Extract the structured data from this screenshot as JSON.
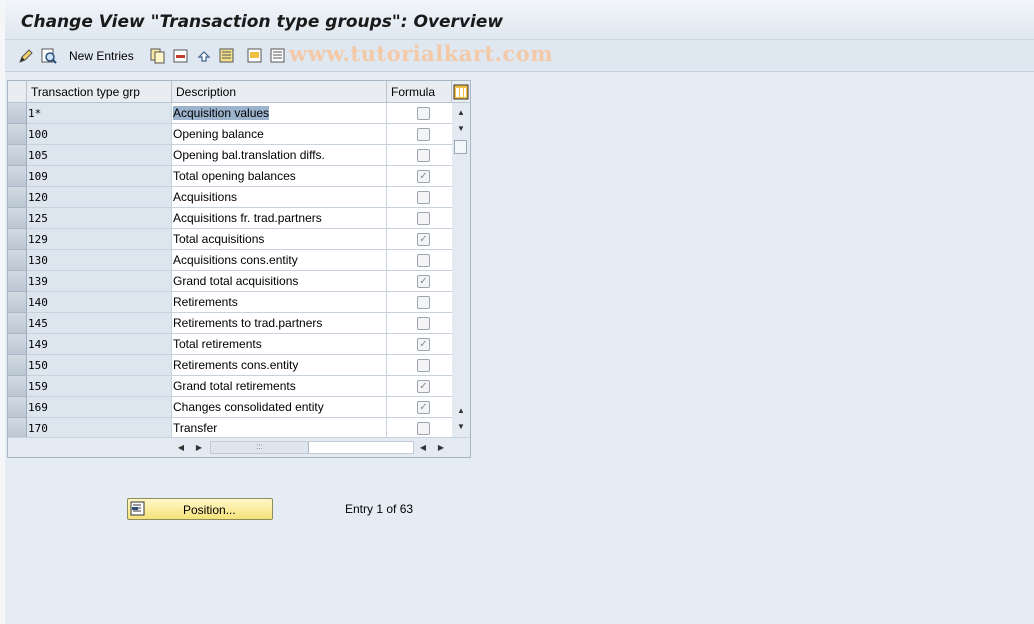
{
  "window": {
    "title": "Change View \"Transaction type groups\": Overview"
  },
  "toolbar": {
    "new_entries_label": "New Entries",
    "watermark": "www.tutorialkart.com",
    "icons": [
      "display-change-icon",
      "details-icon",
      "copy-as-icon",
      "delete-icon",
      "undo-icon",
      "select-all-icon",
      "select-block-icon",
      "deselect-all-icon"
    ]
  },
  "table": {
    "columns": {
      "group": "Transaction type grp",
      "description": "Description",
      "formula": "Formula"
    },
    "rows": [
      {
        "group": "1*",
        "description": "Acquisition values",
        "formula": false,
        "selected": true
      },
      {
        "group": "100",
        "description": "Opening balance",
        "formula": false
      },
      {
        "group": "105",
        "description": "Opening bal.translation diffs.",
        "formula": false
      },
      {
        "group": "109",
        "description": "Total opening balances",
        "formula": true
      },
      {
        "group": "120",
        "description": "Acquisitions",
        "formula": false
      },
      {
        "group": "125",
        "description": "Acquisitions fr. trad.partners",
        "formula": false
      },
      {
        "group": "129",
        "description": "Total acquisitions",
        "formula": true
      },
      {
        "group": "130",
        "description": "Acquisitions cons.entity",
        "formula": false
      },
      {
        "group": "139",
        "description": "Grand total acquisitions",
        "formula": true
      },
      {
        "group": "140",
        "description": "Retirements",
        "formula": false
      },
      {
        "group": "145",
        "description": "Retirements to trad.partners",
        "formula": false
      },
      {
        "group": "149",
        "description": "Total retirements",
        "formula": true
      },
      {
        "group": "150",
        "description": "Retirements cons.entity",
        "formula": false
      },
      {
        "group": "159",
        "description": "Grand total retirements",
        "formula": true
      },
      {
        "group": "169",
        "description": "Changes consolidated entity",
        "formula": true
      },
      {
        "group": "170",
        "description": "Transfer",
        "formula": false
      }
    ]
  },
  "footer": {
    "position_button_label": "Position...",
    "entry_info": "Entry 1 of 63"
  },
  "colors": {
    "title_bg": "#dfe7f0",
    "key_cell_bg": "#dde6ef",
    "position_button": "#f5e27a",
    "selection": "#9bb3cc"
  }
}
